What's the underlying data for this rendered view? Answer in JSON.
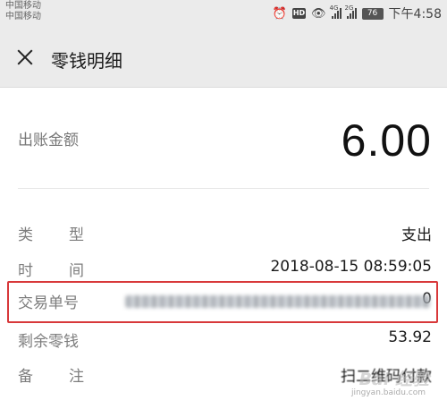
{
  "status_bar": {
    "carrier_1": "中国移动",
    "carrier_2": "中国移动",
    "network_1": "4G",
    "network_2": "2G",
    "battery": "76",
    "time": "下午4:58",
    "icons": [
      "alarm-icon",
      "hd-icon",
      "eye-icon",
      "signal-icon",
      "signal-icon",
      "battery-icon"
    ]
  },
  "nav": {
    "title": "零钱明细"
  },
  "amount": {
    "label": "出账金额",
    "value": "6.00"
  },
  "details": {
    "type": {
      "label": "类型",
      "value": "支出"
    },
    "time": {
      "label": "时间",
      "value": "2018-08-15 08:59:05"
    },
    "transaction_number": {
      "label": "交易单号",
      "value_visible_suffix": "0"
    },
    "balance": {
      "label": "剩余零钱",
      "value": "53.92"
    },
    "note": {
      "label": "备注",
      "value": "扫二维码付款"
    }
  },
  "watermark": {
    "text": "Bai 经验",
    "sub": "jingyan.baidu.com"
  },
  "colors": {
    "highlight_border": "#d8383a",
    "header_bg": "#ebebeb"
  }
}
